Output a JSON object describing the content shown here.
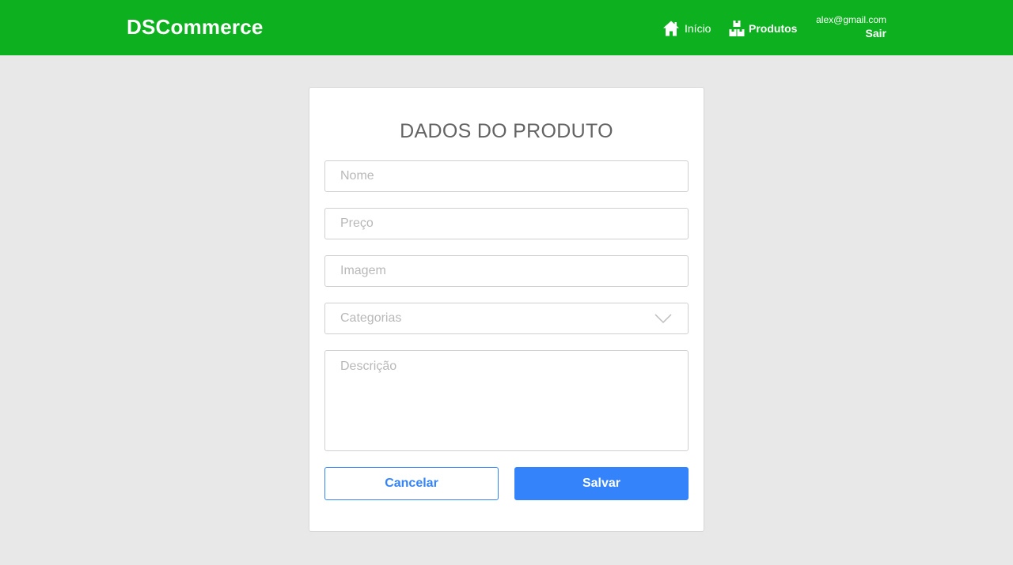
{
  "header": {
    "brand": "DSCommerce",
    "nav": {
      "home_label": "Início",
      "home_icon": "home-icon",
      "products_label": "Produtos",
      "products_icon": "boxes-icon"
    },
    "user": {
      "email": "alex@gmail.com",
      "logout_label": "Sair"
    },
    "background_color": "#0db01e"
  },
  "form": {
    "title": "DADOS DO PRODUTO",
    "fields": {
      "name": {
        "value": "",
        "placeholder": "Nome"
      },
      "price": {
        "value": "",
        "placeholder": "Preço"
      },
      "image": {
        "value": "",
        "placeholder": "Imagem"
      },
      "categories": {
        "selected": "Categorias",
        "icon": "chevron-down-icon"
      },
      "description": {
        "value": "",
        "placeholder": "Descrição"
      }
    },
    "buttons": {
      "cancel_label": "Cancelar",
      "save_label": "Salvar"
    },
    "accent_color": "#3483fa"
  },
  "page": {
    "background_color": "#e8e8e8"
  }
}
